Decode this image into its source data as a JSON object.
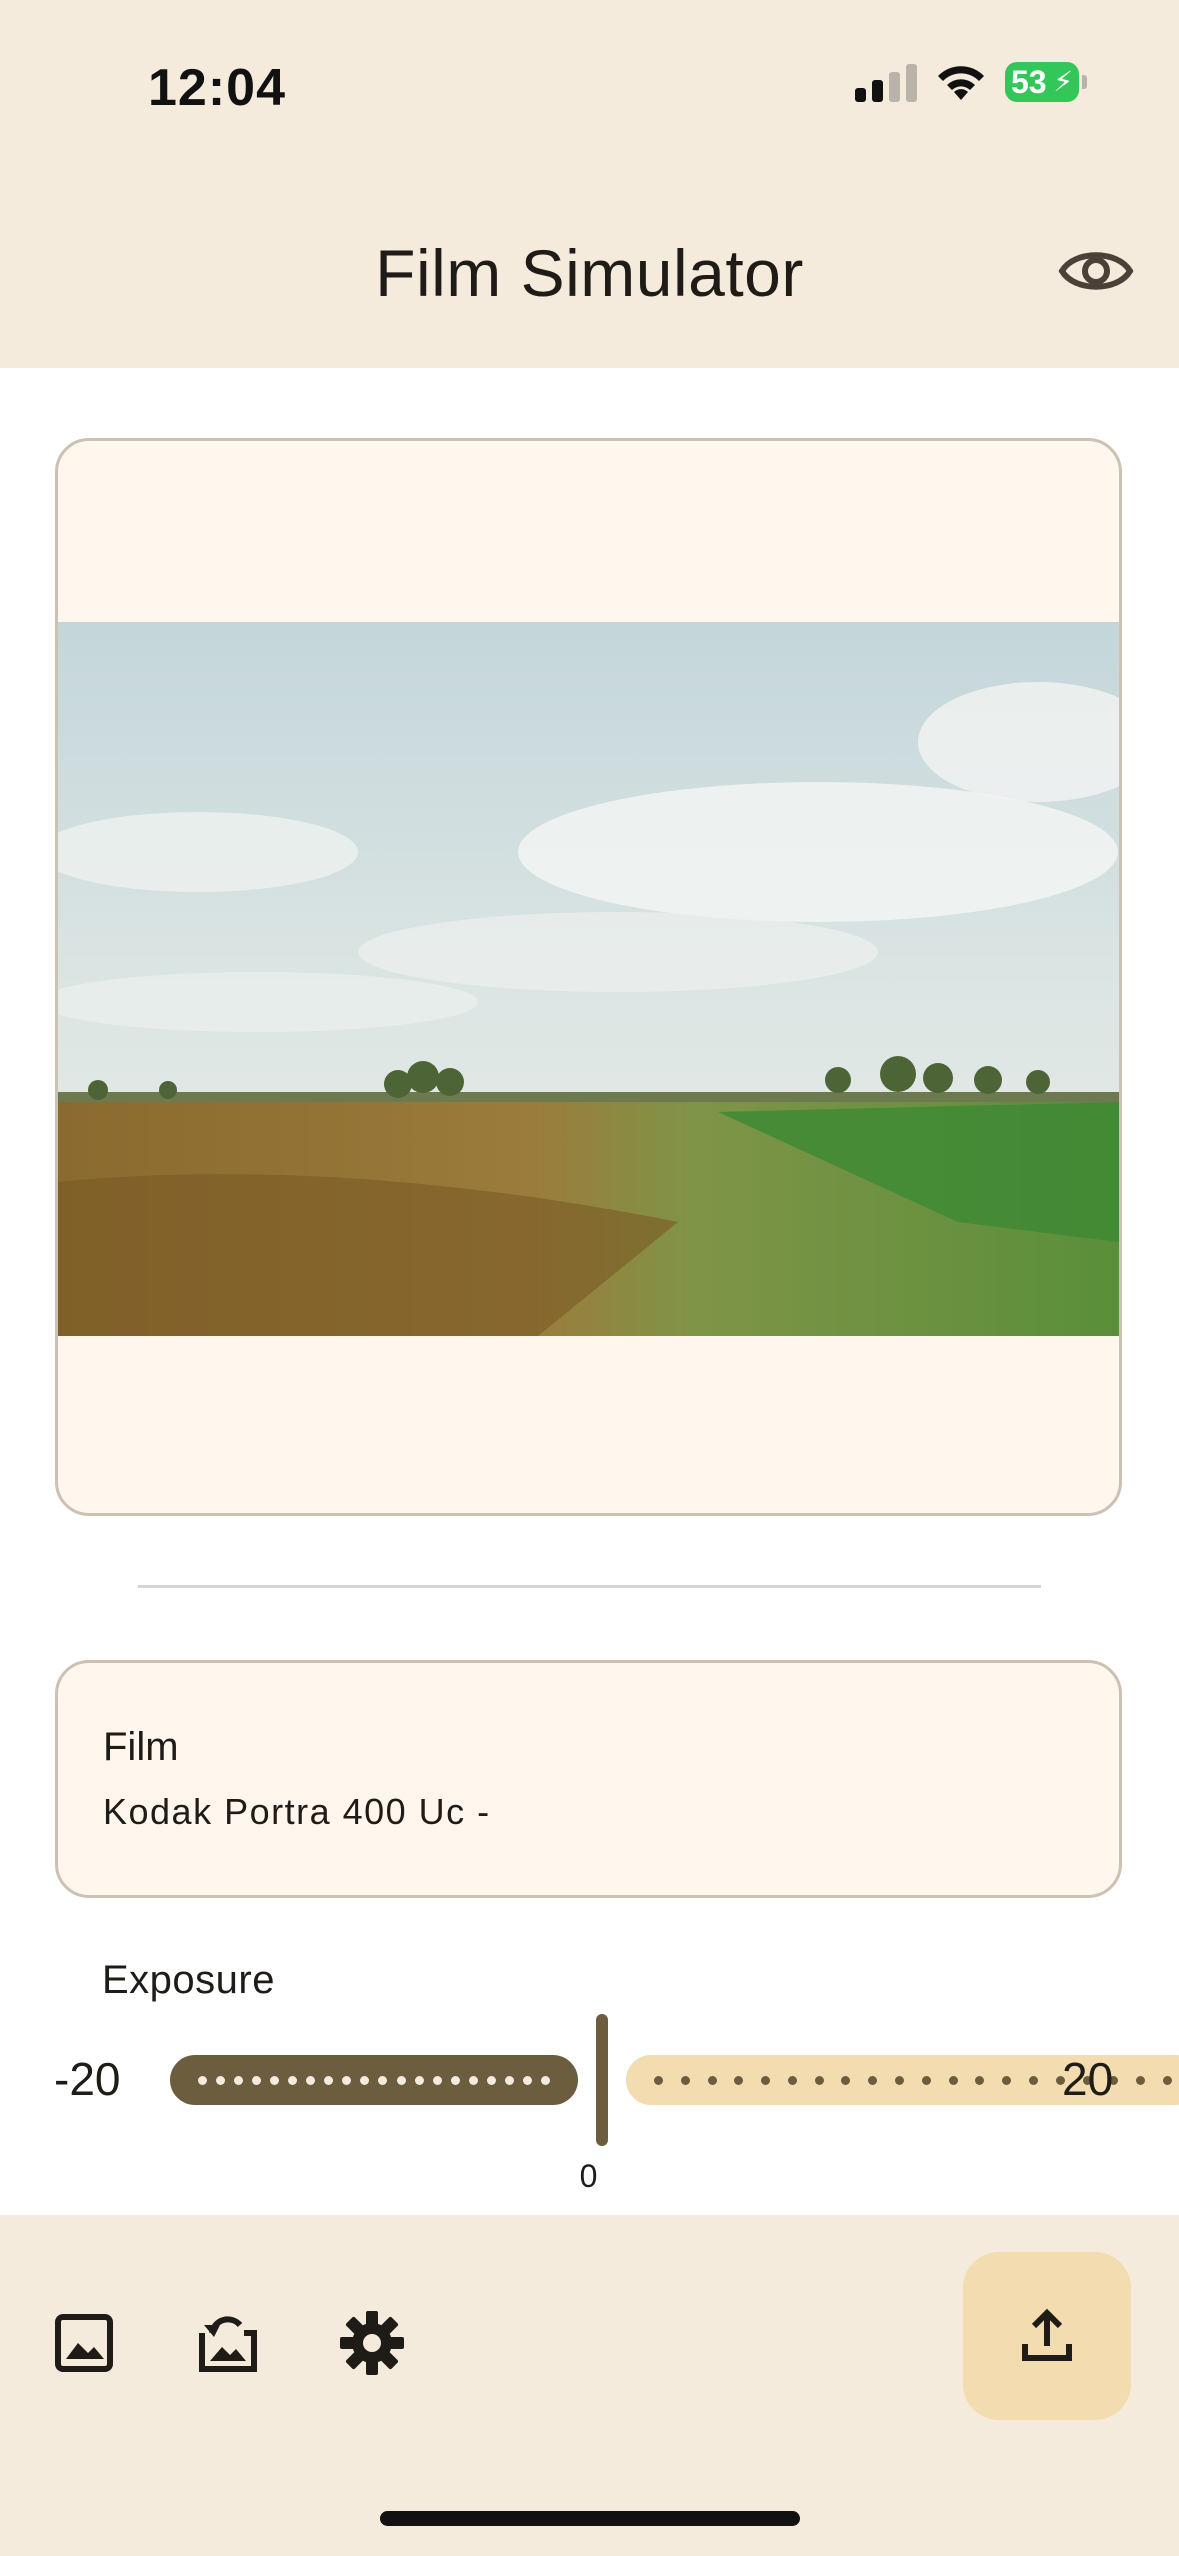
{
  "status_bar": {
    "time": "12:04",
    "battery": "53"
  },
  "app_bar": {
    "title": "Film Simulator",
    "action_icon": "eye-icon"
  },
  "film": {
    "label": "Film",
    "value": "Kodak Portra 400 Uc -"
  },
  "exposure": {
    "label": "Exposure",
    "min": "-20",
    "max": "20",
    "value": "0",
    "current": 0,
    "range": [
      -20,
      20
    ]
  },
  "bottom_bar": {
    "icons": [
      "image-icon",
      "replace-image-icon",
      "gear-icon"
    ],
    "fab_icon": "upload-icon"
  },
  "colors": {
    "bar_background": "#f5ebdc",
    "card_background": "#fff6ee",
    "accent_dark": "#6b5d3e",
    "accent_light": "#f2dcb0"
  }
}
